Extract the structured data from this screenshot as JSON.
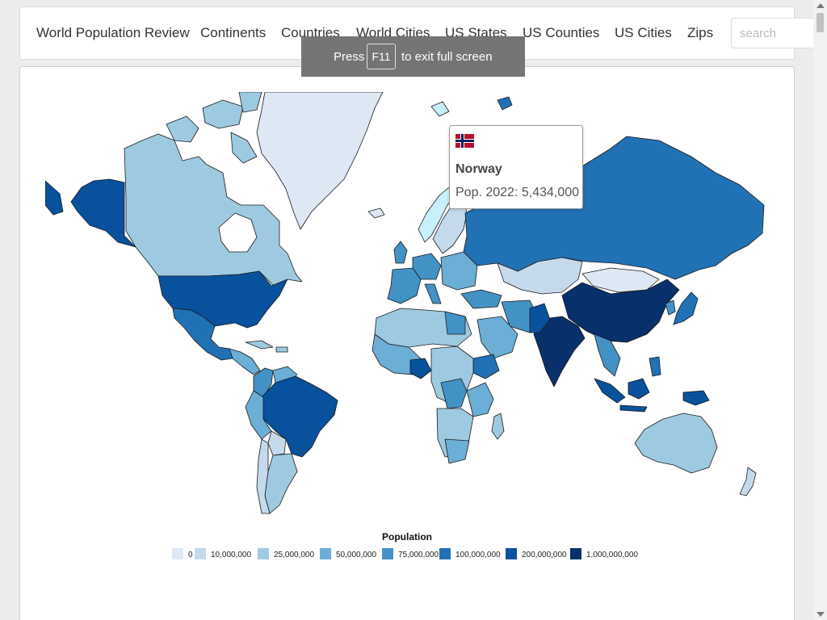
{
  "navbar": {
    "brand": "World Population Review",
    "links": [
      "Continents",
      "Countries",
      "World Cities",
      "US States",
      "US Counties",
      "US Cities",
      "Zips"
    ],
    "search_placeholder": "search"
  },
  "fullscreen_notice": {
    "press": "Press",
    "key": "F11",
    "rest": "to exit full screen"
  },
  "tooltip": {
    "country": "Norway",
    "population_text": "Pop. 2022: 5,434,000"
  },
  "legend": {
    "title": "Population",
    "items": [
      {
        "label": "0",
        "color": "#dee8f4"
      },
      {
        "label": "10,000,000",
        "color": "#c5d9ec"
      },
      {
        "label": "25,000,000",
        "color": "#9ecae1"
      },
      {
        "label": "50,000,000",
        "color": "#6baed6"
      },
      {
        "label": "75,000,000",
        "color": "#4292c6"
      },
      {
        "label": "100,000,000",
        "color": "#2171b5"
      },
      {
        "label": "200,000,000",
        "color": "#08519c"
      },
      {
        "label": "1,000,000,000",
        "color": "#08306b"
      }
    ]
  },
  "map": {
    "highlighted_country": "Norway",
    "highlight_color": "#c7f0fa",
    "border_color": "#1a1a1a"
  }
}
